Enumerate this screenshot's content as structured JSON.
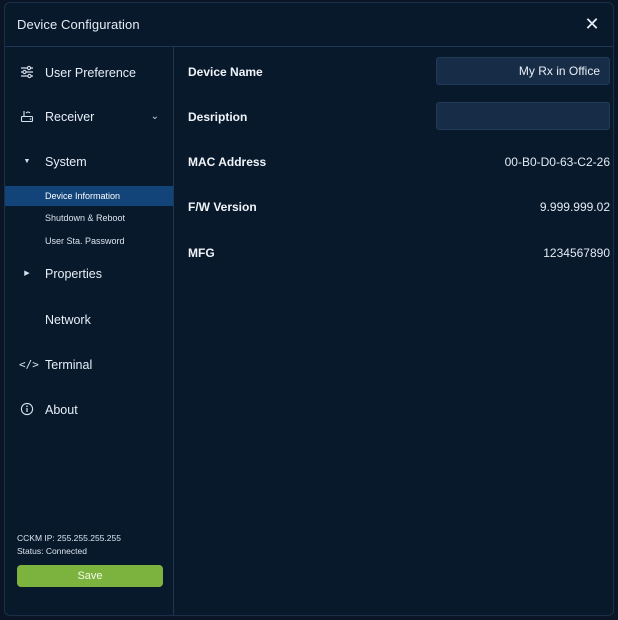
{
  "dialog": {
    "title": "Device Configuration",
    "close_icon": "close-icon"
  },
  "sidebar": {
    "items": [
      {
        "id": "user-preference",
        "label": "User Preference",
        "icon": "sliders-icon"
      },
      {
        "id": "receiver",
        "label": "Receiver",
        "icon": "router-icon",
        "expanded": true
      },
      {
        "id": "system",
        "label": "System",
        "icon": "caret-down-icon",
        "expanded": true
      },
      {
        "id": "properties",
        "label": "Properties",
        "icon": "caret-right-icon"
      },
      {
        "id": "network",
        "label": "Network"
      },
      {
        "id": "terminal",
        "label": "Terminal",
        "icon": "code-icon"
      },
      {
        "id": "about",
        "label": "About",
        "icon": "info-icon"
      }
    ],
    "system_subitems": [
      {
        "label": "Device Information",
        "active": true
      },
      {
        "label": "Shutdown & Reboot"
      },
      {
        "label": "User Sta. Password"
      }
    ],
    "status": {
      "ip_line": "CCKM IP:  255.255.255.255",
      "status_line": "Status: Connected"
    },
    "save_label": "Save"
  },
  "content": {
    "device_name": {
      "label": "Device Name",
      "value": "My Rx in Office"
    },
    "description": {
      "label": "Desription",
      "value": ""
    },
    "mac_address": {
      "label": "MAC Address",
      "value": "00-B0-D0-63-C2-26"
    },
    "fw_version": {
      "label": "F/W Version",
      "value": "9.999.999.02"
    },
    "mfg": {
      "label": "MFG",
      "value": "1234567890"
    }
  },
  "colors": {
    "background": "#08192c",
    "active_item": "#12447a",
    "input_bg": "#172d47",
    "save_button": "#7cb23e",
    "divider": "#1e3654"
  }
}
